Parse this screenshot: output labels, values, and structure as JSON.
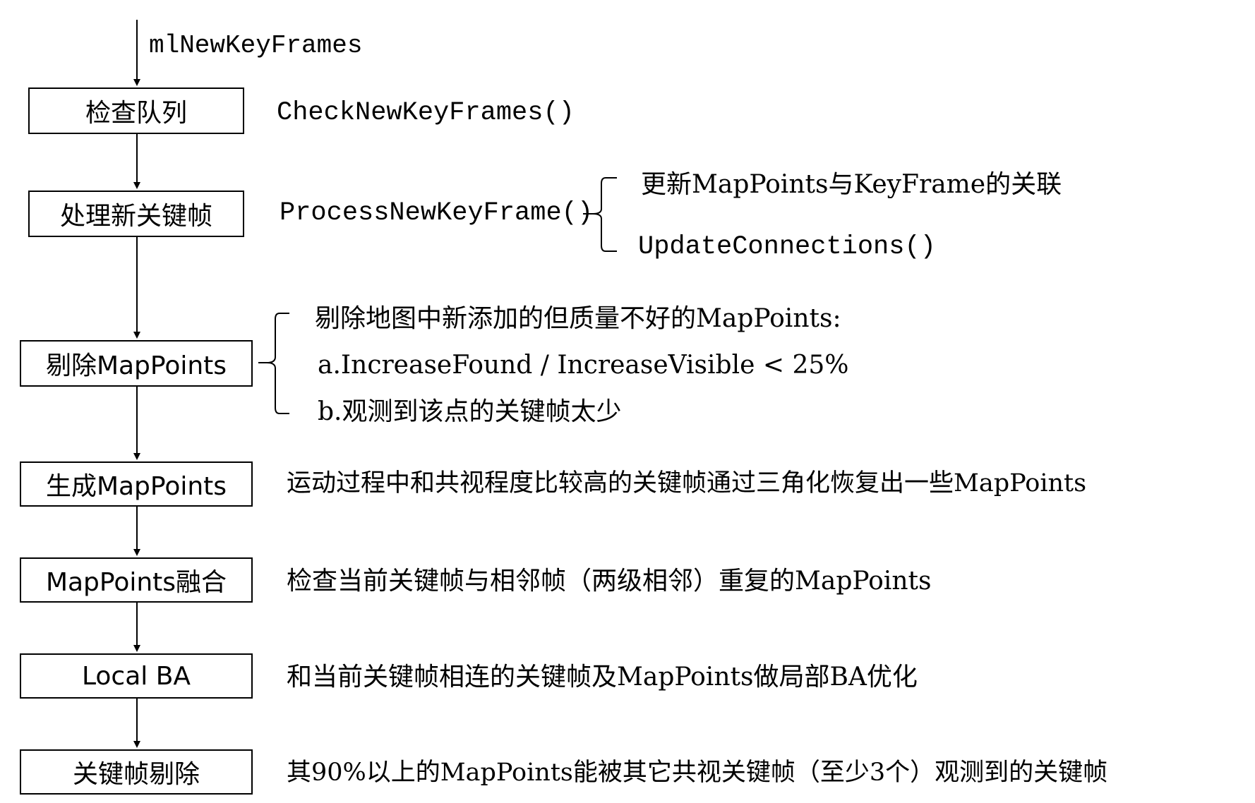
{
  "input_label": "mlNewKeyFrames",
  "steps": [
    {
      "label": "检查队列",
      "desc": "CheckNewKeyFrames()"
    },
    {
      "label": "处理新关键帧",
      "desc": "ProcessNewKeyFrame()"
    },
    {
      "label": "剔除MapPoints",
      "desc": ""
    },
    {
      "label": "生成MapPoints",
      "desc": "运动过程中和共视程度比较高的关键帧通过三角化恢复出一些MapPoints"
    },
    {
      "label": "MapPoints融合",
      "desc": "检查当前关键帧与相邻帧（两级相邻）重复的MapPoints"
    },
    {
      "label": "Local BA",
      "desc": "和当前关键帧相连的关键帧及MapPoints做局部BA优化"
    },
    {
      "label": "关键帧剔除",
      "desc": "其90%以上的MapPoints能被其它共视关键帧（至少3个）观测到的关键帧"
    }
  ],
  "process_branch": [
    "更新MapPoints与KeyFrame的关联",
    "UpdateConnections()"
  ],
  "cull_branch": [
    "剔除地图中新添加的但质量不好的MapPoints:",
    "a.IncreaseFound / IncreaseVisible < 25%",
    "b.观测到该点的关键帧太少"
  ]
}
